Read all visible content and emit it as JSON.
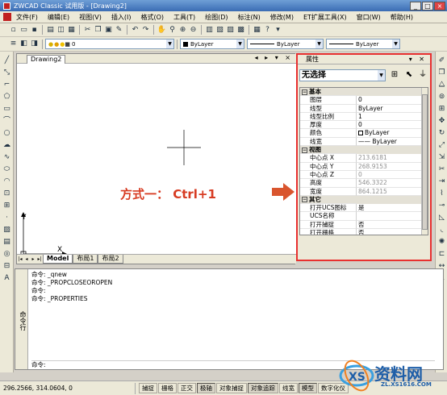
{
  "window": {
    "title": "ZWCAD Classic 试用版 - [Drawing2]",
    "min": "_",
    "max": "□",
    "close": "×"
  },
  "menu": [
    "文件(F)",
    "编辑(E)",
    "视图(V)",
    "插入(I)",
    "格式(O)",
    "工具(T)",
    "绘图(D)",
    "标注(N)",
    "修改(M)",
    "ET扩展工具(X)",
    "窗口(W)",
    "帮助(H)"
  ],
  "layer_combo": {
    "value": "0"
  },
  "color_combo": {
    "value": "ByLayer"
  },
  "linetype_combo": {
    "value": "ByLayer"
  },
  "lineweight_combo": {
    "value": "ByLayer"
  },
  "drawing_tab": {
    "name": "Drawing2",
    "controls": "◂ ▸ ▾ ×"
  },
  "layout_tabs": [
    "Model",
    "布局1",
    "布局2"
  ],
  "axis": {
    "x": "X",
    "y": "Y"
  },
  "hint": "方式一： Ctrl+1",
  "properties": {
    "title": "属性",
    "controls": "▾ ✕",
    "selection": "无选择",
    "rows": [
      {
        "k": "基本",
        "cat": true
      },
      {
        "k": "图层",
        "v": "0"
      },
      {
        "k": "线型",
        "v": "ByLayer"
      },
      {
        "k": "线型比例",
        "v": "1"
      },
      {
        "k": "厚度",
        "v": "0"
      },
      {
        "k": "颜色",
        "v": "ByLayer",
        "box": true
      },
      {
        "k": "线宽",
        "v": "—— ByLayer"
      },
      {
        "k": "视图",
        "cat": true
      },
      {
        "k": "中心点 X",
        "v": "213.6181",
        "dis": true
      },
      {
        "k": "中心点 Y",
        "v": "268.9153",
        "dis": true
      },
      {
        "k": "中心点 Z",
        "v": "0",
        "dis": true
      },
      {
        "k": "高度",
        "v": "546.3322",
        "dis": true
      },
      {
        "k": "宽度",
        "v": "864.1215",
        "dis": true
      },
      {
        "k": "其它",
        "cat": true
      },
      {
        "k": "打开UCS图标",
        "v": "是"
      },
      {
        "k": "UCS名称",
        "v": ""
      },
      {
        "k": "打开捕捉",
        "v": "否"
      },
      {
        "k": "打开栅格",
        "v": "否"
      }
    ]
  },
  "command": {
    "title": "命令行",
    "lines": [
      "命令: _qnew",
      "命令: _PROPCLOSEOROPEN",
      "命令:",
      "命令: _PROPERTIES"
    ],
    "prompt": "命令:"
  },
  "status": {
    "coords": "296.2566,  314.0604,  0",
    "buttons": [
      "捕捉",
      "栅格",
      "正交",
      "极轴",
      "对象捕捉",
      "对象追踪",
      "线宽",
      "模型",
      "数字化仪"
    ]
  },
  "watermark": {
    "text": "资料网",
    "url": "ZL.XS1616.COM"
  }
}
